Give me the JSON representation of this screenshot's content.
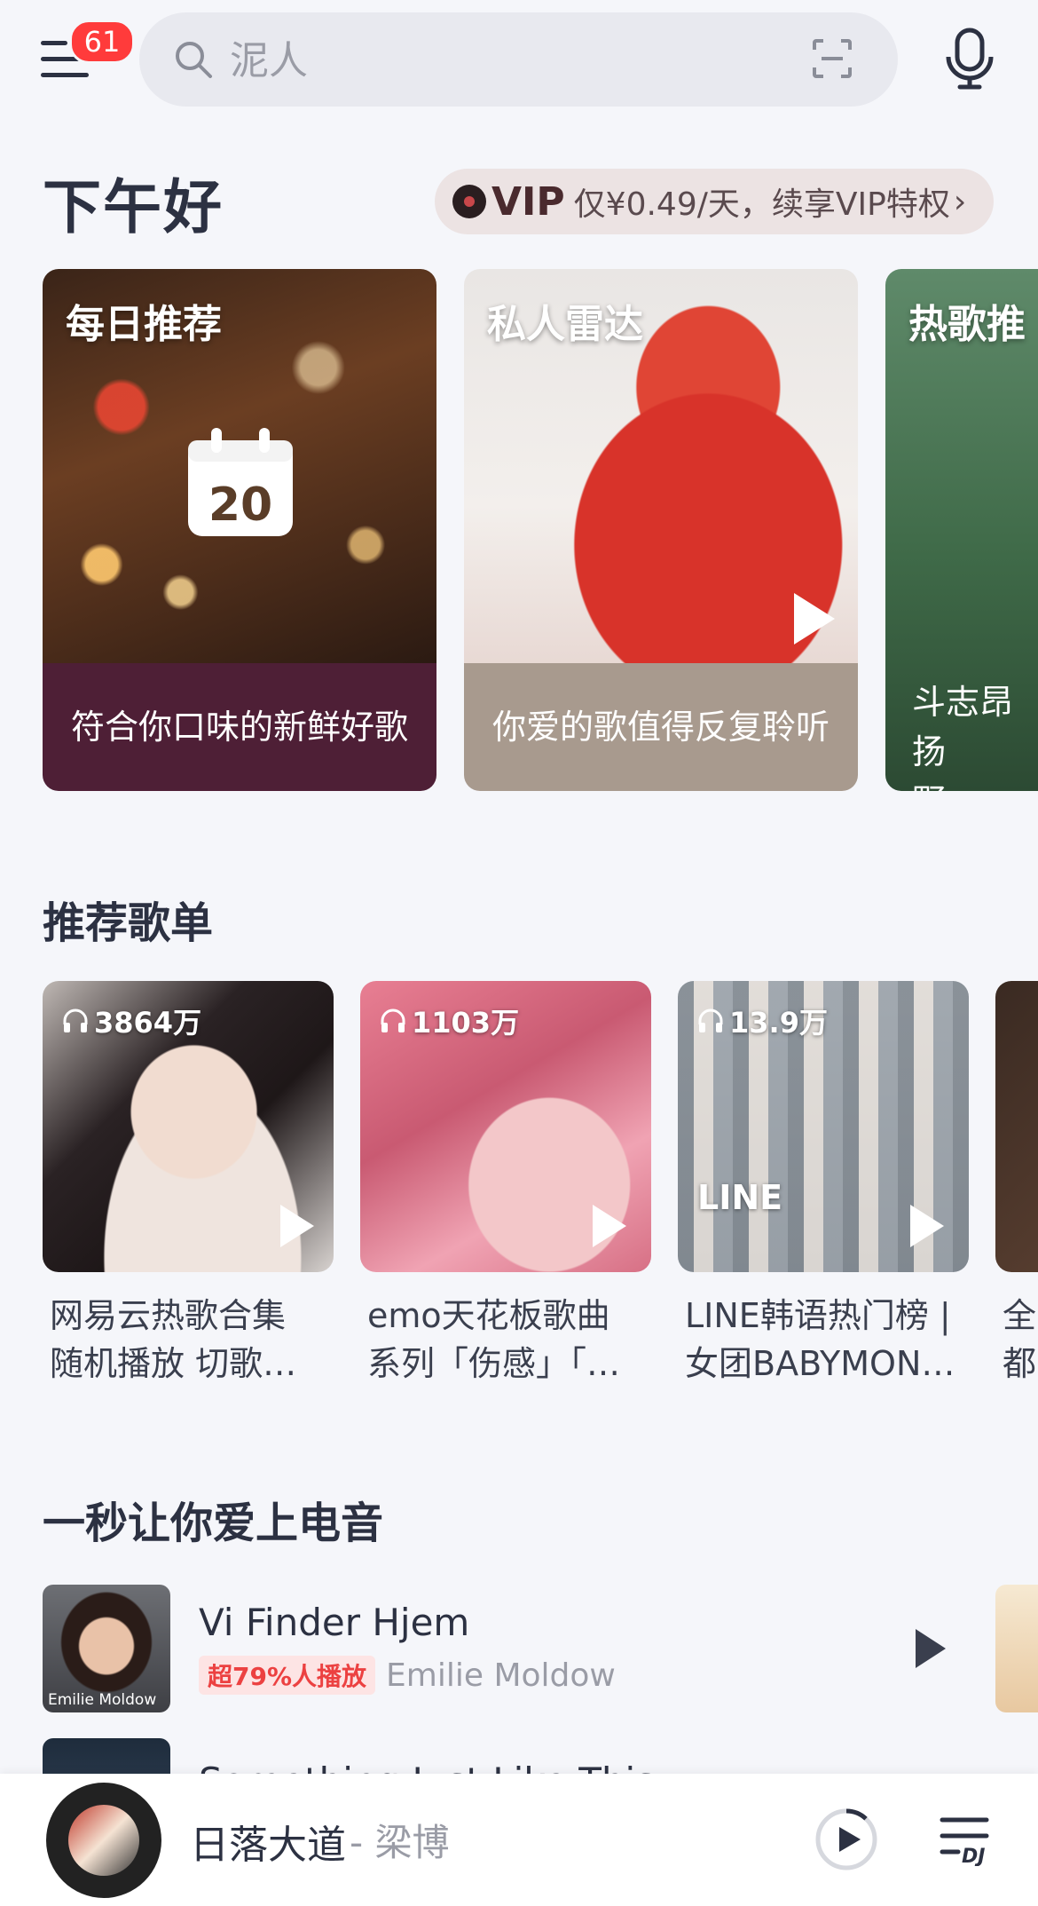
{
  "topbar": {
    "badge_count": "61",
    "search_placeholder": "泥人"
  },
  "greeting": "下午好",
  "vip": {
    "word": "VIP",
    "text": "仅¥0.49/天，续享VIP特权",
    "arrow": "›"
  },
  "features": [
    {
      "title": "每日推荐",
      "caption": "符合你口味的新鲜好歌",
      "calendar_day": "20"
    },
    {
      "title": "私人雷达",
      "caption": "你爱的歌值得反复聆听"
    },
    {
      "title": "热歌推",
      "caption": "斗志昂扬\n野"
    }
  ],
  "sections": {
    "playlists_title": "推荐歌单",
    "songs_title": "一秒让你爱上电音"
  },
  "playlists": [
    {
      "plays": "3864万",
      "name": "网易云热歌合集\n随机播放 切歌…"
    },
    {
      "plays": "1103万",
      "name": "emo天花板歌曲\n系列「伤感」「…"
    },
    {
      "plays": "13.9万",
      "name": "LINE韩语热门榜 |\n女团BABYMON…",
      "cover_text": "LINE"
    },
    {
      "plays": "",
      "name": "全\n都"
    }
  ],
  "songs": [
    {
      "title": "Vi Finder Hjem",
      "tag": "超79%人播放",
      "artist": "Emilie Moldow",
      "thumb_caption": "Emilie Moldow"
    },
    {
      "title": "Something Just Like This",
      "tag": "",
      "artist": ""
    }
  ],
  "now_playing": {
    "title": "日落大道",
    "separator": " - ",
    "artist": "梁博",
    "list_label": "DJ"
  },
  "colors": {
    "accent_red": "#ec4141",
    "badge_red": "#ff3b3b",
    "background": "#f5f6fa"
  }
}
